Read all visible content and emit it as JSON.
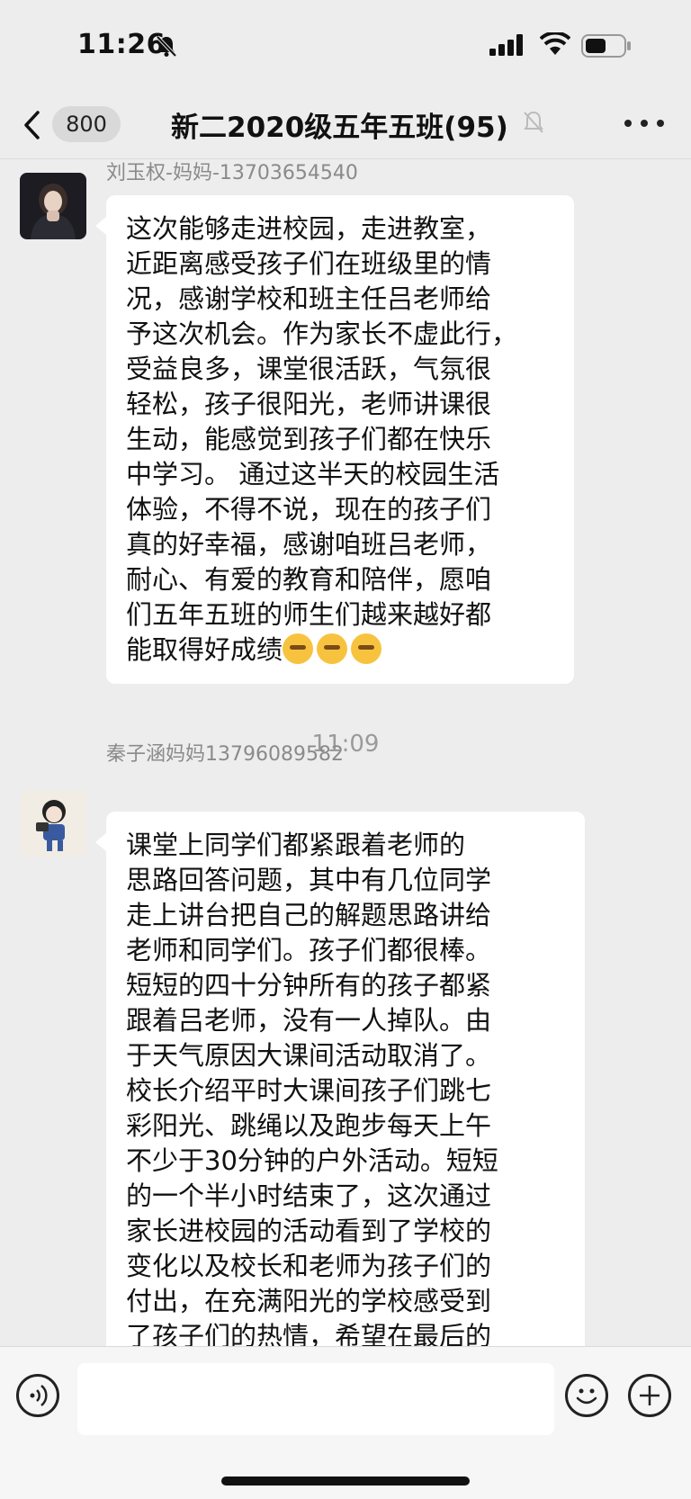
{
  "status_bar": {
    "time": "11:26",
    "icons": [
      "bell-slash-icon",
      "cellular-signal-icon",
      "wifi-icon",
      "battery-icon"
    ]
  },
  "nav": {
    "back_icon": "chevron-left-icon",
    "unread_count": "800",
    "title": "新二2020级五年五班(95)",
    "mute_icon": "bell-slash-icon",
    "more_icon": "ellipsis-icon"
  },
  "messages": [
    {
      "sender": "刘玉权-妈妈-13703654540",
      "text": "这次能够走进校园，走进教室，\n近距离感受孩子们在班级里的情\n况，感谢学校和班主任吕老师给\n予这次机会。作为家长不虚此行，\n受益良多，课堂很活跃，气氛很\n轻松，孩子很阳光，老师讲课很\n生动，能感觉到孩子们都在快乐\n中学习。 通过这半天的校园生活\n体验，不得不说，现在的孩子们\n真的好幸福，感谢咱班吕老师，\n耐心、有爱的教育和陪伴，愿咱\n们五年五班的师生们越来越好都\n能取得好成绩",
      "emoji_icon": "shushing-face-emoji-icon"
    },
    {
      "sender": "秦子涵妈妈13796089582",
      "text": "        课堂上同学们都紧跟着老师的\n思路回答问题，其中有几位同学\n走上讲台把自己的解题思路讲给\n老师和同学们。孩子们都很棒。\n短短的四十分钟所有的孩子都紧\n跟着吕老师，没有一人掉队。由\n于天气原因大课间活动取消了。\n校长介绍平时大课间孩子们跳七\n彩阳光、跳绳以及跑步每天上午\n不少于30分钟的户外活动。短短\n的一个半小时结束了，这次通过\n家长进校园的活动看到了学校的\n变化以及校长和老师为孩子们的\n付出，在充满阳光的学校感受到\n了孩子们的热情，希望在最后的"
    }
  ],
  "timestamp": "11:09",
  "input_bar": {
    "voice_icon": "voice-input-icon",
    "input_placeholder": "",
    "emoji_icon": "smiley-face-icon",
    "plus_icon": "plus-circle-icon"
  },
  "colors": {
    "background": "#ededed",
    "bubble": "#ffffff",
    "secondary_text": "#8a8a8a"
  }
}
